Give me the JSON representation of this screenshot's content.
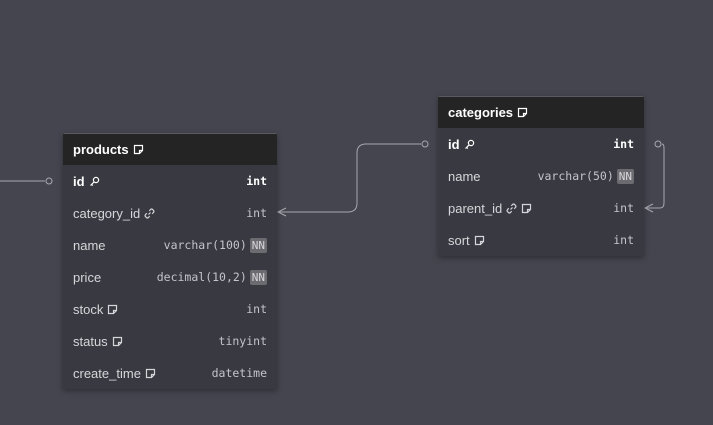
{
  "tables": [
    {
      "name": "products",
      "columns": [
        {
          "name": "id",
          "type": "int",
          "icons": [
            "key"
          ],
          "nn": false,
          "pk": true
        },
        {
          "name": "category_id",
          "type": "int",
          "icons": [
            "link"
          ],
          "nn": false,
          "pk": false
        },
        {
          "name": "name",
          "type": "varchar(100)",
          "icons": [],
          "nn": true,
          "pk": false
        },
        {
          "name": "price",
          "type": "decimal(10,2)",
          "icons": [],
          "nn": true,
          "pk": false
        },
        {
          "name": "stock",
          "type": "int",
          "icons": [
            "note"
          ],
          "nn": false,
          "pk": false
        },
        {
          "name": "status",
          "type": "tinyint",
          "icons": [
            "note"
          ],
          "nn": false,
          "pk": false
        },
        {
          "name": "create_time",
          "type": "datetime",
          "icons": [
            "note"
          ],
          "nn": false,
          "pk": false
        }
      ]
    },
    {
      "name": "categories",
      "columns": [
        {
          "name": "id",
          "type": "int",
          "icons": [
            "key"
          ],
          "nn": false,
          "pk": true
        },
        {
          "name": "name",
          "type": "varchar(50)",
          "icons": [],
          "nn": true,
          "pk": false
        },
        {
          "name": "parent_id",
          "type": "int",
          "icons": [
            "link",
            "note"
          ],
          "nn": false,
          "pk": false
        },
        {
          "name": "sort",
          "type": "int",
          "icons": [
            "note"
          ],
          "nn": false,
          "pk": false
        }
      ]
    }
  ],
  "nn_label": "NN",
  "colors": {
    "background": "#45454f",
    "table_body": "#393941",
    "table_header": "#242424",
    "connector": "#a8a8b0"
  }
}
